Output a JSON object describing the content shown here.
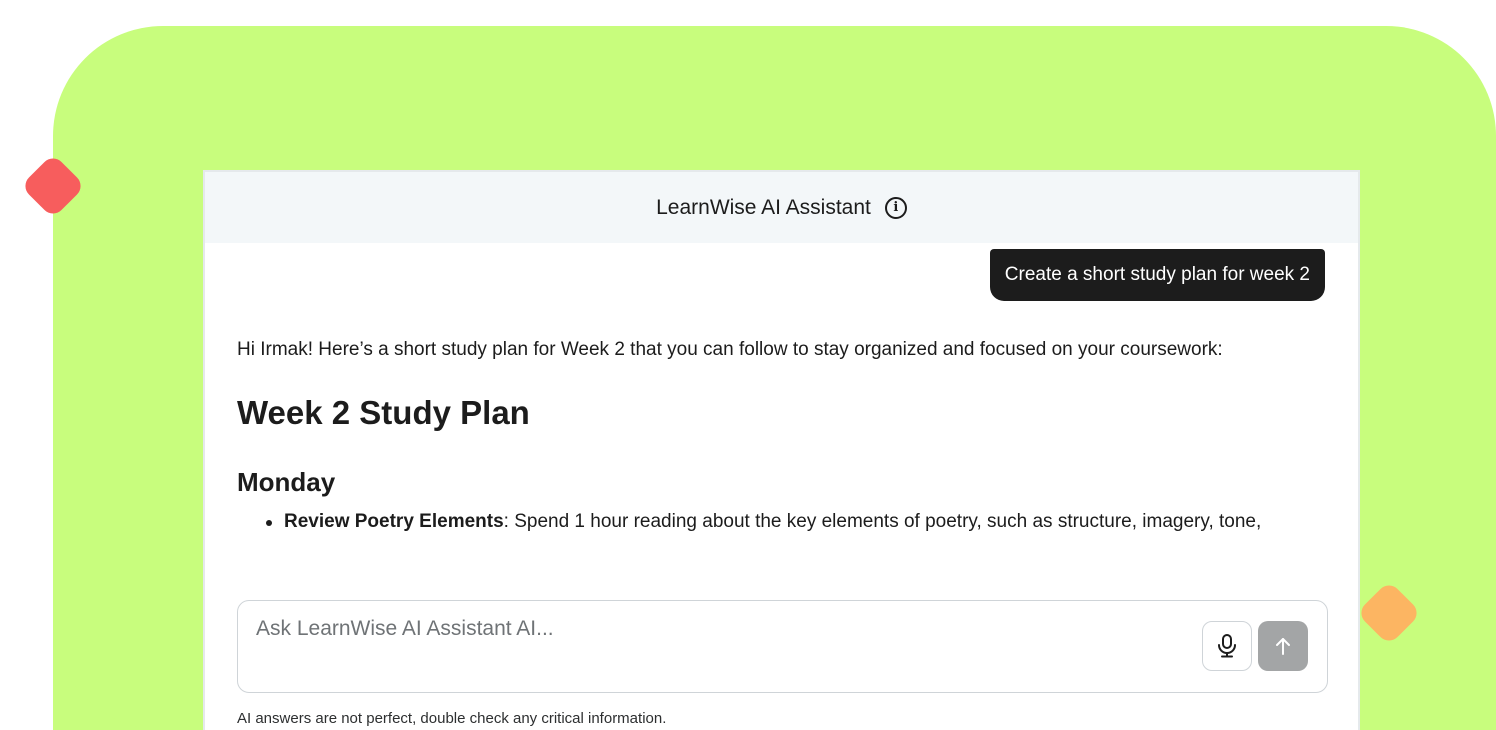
{
  "theme": {
    "backdrop_color": "#c8fd7d",
    "deco_left_color": "#f75d5d",
    "deco_right_color": "#fcb562",
    "bubble_color": "#1c1c1c",
    "send_button_color": "#a3a5a6"
  },
  "header": {
    "title": "LearnWise AI Assistant",
    "info_icon": "info-icon"
  },
  "conversation": {
    "user_message": "Create a short study plan for week 2",
    "assistant": {
      "intro": "Hi Irmak! Here’s a short study plan for Week 2 that you can follow to stay organized and focused on your coursework:",
      "heading": "Week 2 Study Plan",
      "day_heading": "Monday",
      "items": [
        {
          "title": "Review Poetry Elements",
          "text": ": Spend 1 hour reading about the key elements of poetry, such as structure, imagery, tone,"
        }
      ]
    }
  },
  "composer": {
    "placeholder": "Ask LearnWise AI Assistant AI...",
    "mic_icon": "microphone-icon",
    "send_icon": "arrow-up-icon"
  },
  "footer": {
    "disclaimer": "AI answers are not perfect, double check any critical information."
  }
}
